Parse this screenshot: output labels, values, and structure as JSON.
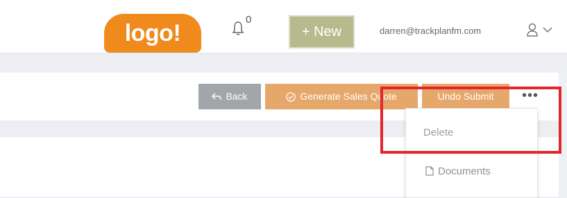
{
  "header": {
    "logo_text": "logo!",
    "notifications_count": "0",
    "new_button_label": "+ New",
    "user_email": "darren@trackplanfm.com"
  },
  "toolbar": {
    "back_label": "Back",
    "generate_quote_label": "Generate Sales Quote",
    "undo_submit_label": "Undo Submit",
    "more_label": "•••"
  },
  "dropdown": {
    "items": [
      {
        "label": "Delete",
        "icon": ""
      },
      {
        "label": "Documents",
        "icon": "document-icon"
      }
    ]
  },
  "colors": {
    "brand_orange": "#f08a1d",
    "new_button": "#b6bb8e",
    "action_orange": "#e6a76b",
    "back_grey": "#a2a6ab",
    "highlight_red": "#e2262e"
  }
}
